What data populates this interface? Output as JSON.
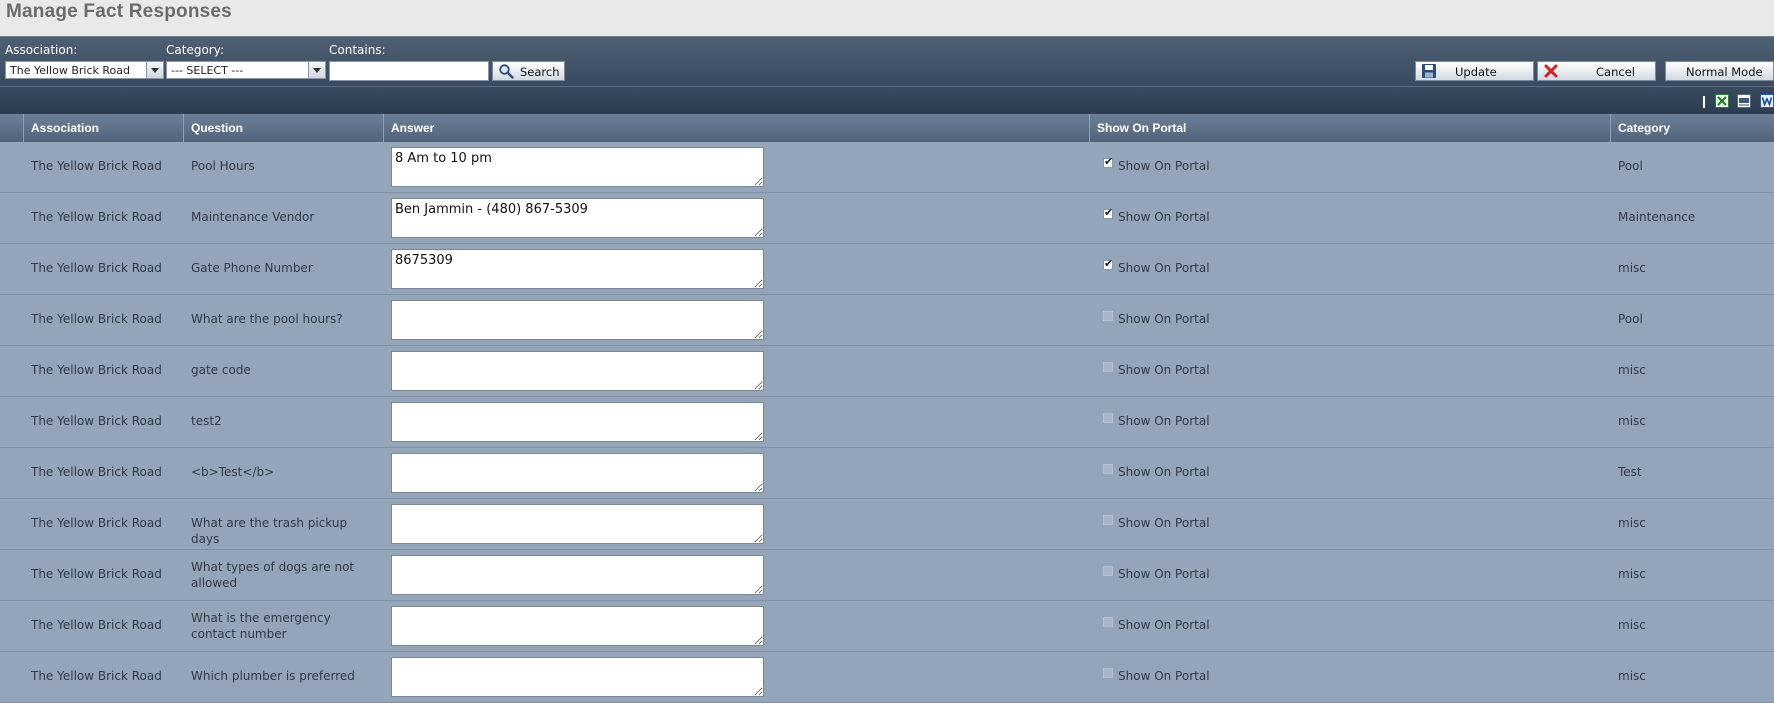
{
  "page": {
    "title": "Manage Fact Responses"
  },
  "filters": {
    "association_label": "Association:",
    "association_value": "The Yellow Brick Road",
    "category_label": "Category:",
    "category_value": "--- SELECT ---",
    "contains_label": "Contains:",
    "contains_value": "",
    "search_button": "Search"
  },
  "actions": {
    "update_button": "Update",
    "cancel_button": "Cancel",
    "mode_button": "Normal Mode"
  },
  "toolbar": {
    "icons": [
      "excel-export-icon",
      "csv-export-icon",
      "word-export-icon"
    ]
  },
  "grid": {
    "columns": {
      "association": "Association",
      "question": "Question",
      "answer": "Answer",
      "show_on_portal": "Show On Portal",
      "category": "Category"
    },
    "checkbox_label": "Show On Portal",
    "rows": [
      {
        "association": "The Yellow Brick Road",
        "question": "Pool Hours",
        "answer": "8 Am to 10 pm",
        "show_on_portal": true,
        "category": "Pool"
      },
      {
        "association": "The Yellow Brick Road",
        "question": "Maintenance Vendor",
        "answer": "Ben Jammin - (480) 867-5309",
        "show_on_portal": true,
        "category": "Maintenance"
      },
      {
        "association": "The Yellow Brick Road",
        "question": "Gate Phone Number",
        "answer": "8675309",
        "show_on_portal": true,
        "category": "misc"
      },
      {
        "association": "The Yellow Brick Road",
        "question": "What are the pool hours?",
        "answer": "",
        "show_on_portal": false,
        "category": "Pool"
      },
      {
        "association": "The Yellow Brick Road",
        "question": "gate code",
        "answer": "",
        "show_on_portal": false,
        "category": "misc"
      },
      {
        "association": "The Yellow Brick Road",
        "question": "test2",
        "answer": "",
        "show_on_portal": false,
        "category": "misc"
      },
      {
        "association": "The Yellow Brick Road",
        "question": "<b>Test</b>",
        "answer": "",
        "show_on_portal": false,
        "category": "Test"
      },
      {
        "association": "The Yellow Brick Road",
        "question": "What are the trash pickup days",
        "answer": "",
        "show_on_portal": false,
        "category": "misc"
      },
      {
        "association": "The Yellow Brick Road",
        "question": "What types of dogs are not allowed",
        "answer": "",
        "show_on_portal": false,
        "category": "misc"
      },
      {
        "association": "The Yellow Brick Road",
        "question": "What is the emergency contact number",
        "answer": "",
        "show_on_portal": false,
        "category": "misc"
      },
      {
        "association": "The Yellow Brick Road",
        "question": "Which plumber is preferred",
        "answer": "",
        "show_on_portal": false,
        "category": "misc"
      }
    ]
  },
  "colors": {
    "title": "#6b6b6b",
    "toolbar_bg": "#3a4a5e",
    "header_bg": "#5e7088",
    "row_bg": "#95a5b9",
    "row_text": "#2f3a46"
  }
}
